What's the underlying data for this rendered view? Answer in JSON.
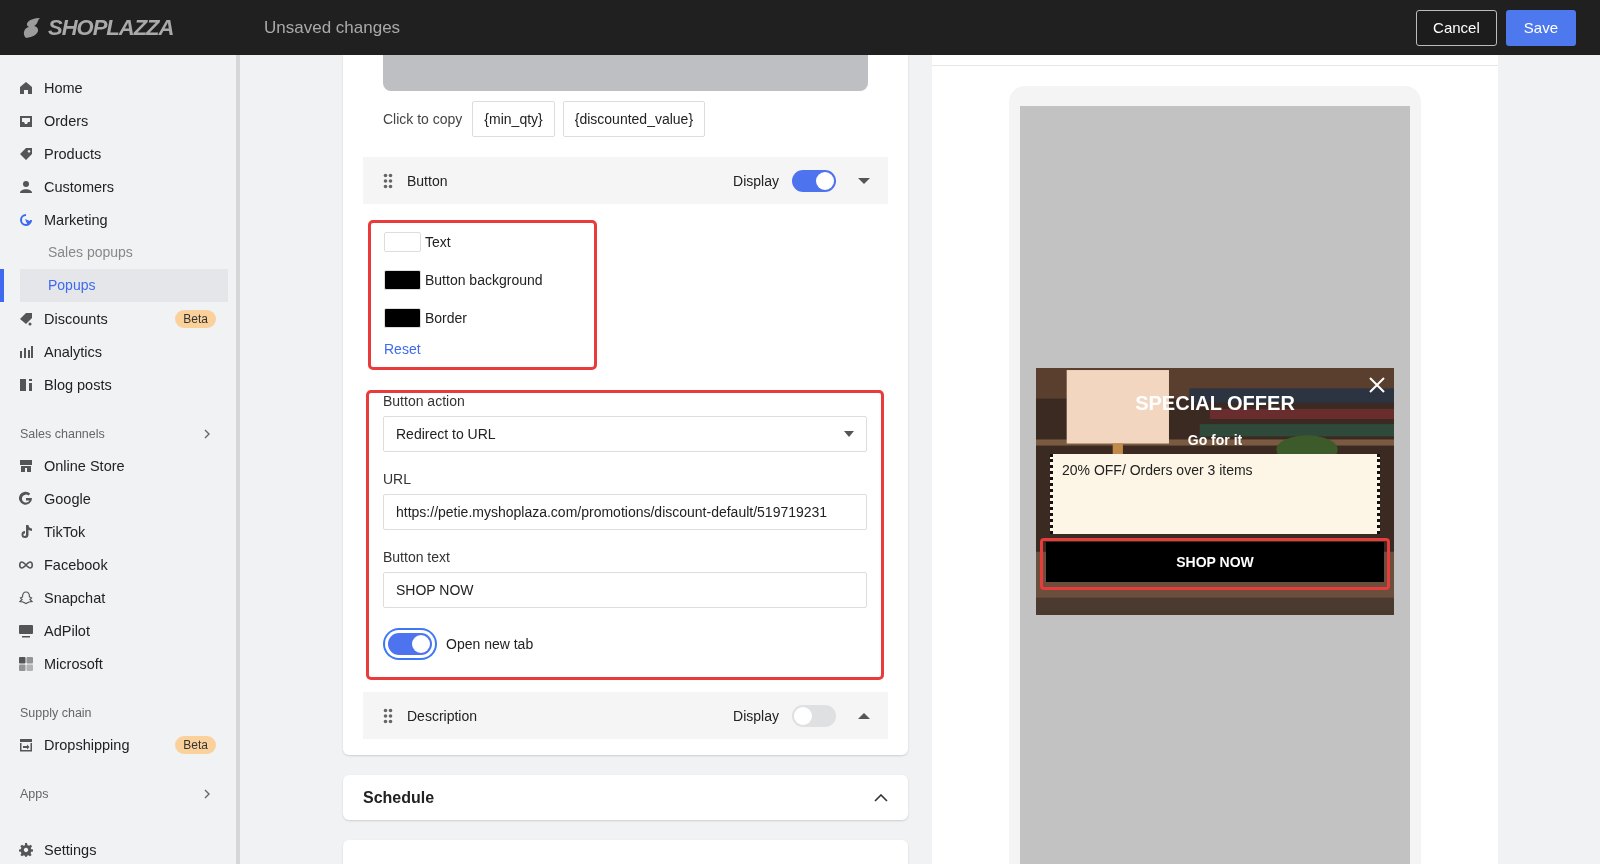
{
  "header": {
    "logo": "SHOPLAZZA",
    "title": "Unsaved changes",
    "buttons": [
      {
        "label": "Cancel",
        "kind": "secondary"
      },
      {
        "label": "Save",
        "kind": "primary"
      }
    ]
  },
  "sidebar": {
    "groups": [
      {
        "items": [
          {
            "label": "Home",
            "selected": false
          },
          {
            "label": "Orders",
            "selected": false
          },
          {
            "label": "Products",
            "selected": false
          },
          {
            "label": "Customers",
            "selected": false
          },
          {
            "label": "Marketing",
            "selected": false,
            "expanded": true,
            "children": [
              {
                "label": "Sales popups",
                "selected": false
              },
              {
                "label": "Popups",
                "selected": true
              }
            ]
          },
          {
            "label": "Discounts",
            "selected": false,
            "badge": "Beta"
          },
          {
            "label": "Analytics",
            "selected": false
          },
          {
            "label": "Blog posts",
            "selected": false
          }
        ]
      },
      {
        "heading": "Sales channels",
        "expandable": true,
        "items": [
          {
            "label": "Online Store",
            "selected": false
          },
          {
            "label": "Google",
            "selected": false
          },
          {
            "label": "TikTok",
            "selected": false
          },
          {
            "label": "Facebook",
            "selected": false
          },
          {
            "label": "Snapchat",
            "selected": false
          },
          {
            "label": "AdPilot",
            "selected": false
          },
          {
            "label": "Microsoft",
            "selected": false
          }
        ]
      },
      {
        "heading": "Supply chain",
        "expandable": false,
        "items": [
          {
            "label": "Dropshipping",
            "selected": false,
            "badge": "Beta"
          }
        ]
      },
      {
        "heading": "Apps",
        "expandable": true
      },
      {
        "items": [
          {
            "label": "Settings",
            "selected": false
          }
        ]
      }
    ]
  },
  "editor": {
    "copy": {
      "label": "Click to copy",
      "tokens": [
        "{min_qty}",
        "{discounted_value}"
      ]
    },
    "sections": [
      {
        "title": "Button",
        "display_label": "Display",
        "on": true,
        "expanded": true,
        "colors": [
          {
            "label": "Text",
            "color": "#ffffff"
          },
          {
            "label": "Button background",
            "color": "#000000"
          },
          {
            "label": "Border",
            "color": "#000000"
          }
        ],
        "reset": "Reset",
        "fields": [
          {
            "kind": "select",
            "label": "Button action",
            "value": "Redirect to URL"
          },
          {
            "kind": "text",
            "label": "URL",
            "value": "https://petie.myshoplaza.com/promotions/discount-default/519719231"
          },
          {
            "kind": "text",
            "label": "Button text",
            "value": "SHOP NOW"
          }
        ],
        "open_new_tab": {
          "label": "Open new tab",
          "on": true
        }
      },
      {
        "title": "Description",
        "display_label": "Display",
        "on": false,
        "expanded": false
      }
    ],
    "schedule": {
      "title": "Schedule",
      "expanded": true
    }
  },
  "preview": {
    "title": "SPECIAL OFFER",
    "subtitle": "Go for it",
    "coupon": "20% OFF/ Orders over 3 items",
    "button": "SHOP NOW"
  }
}
